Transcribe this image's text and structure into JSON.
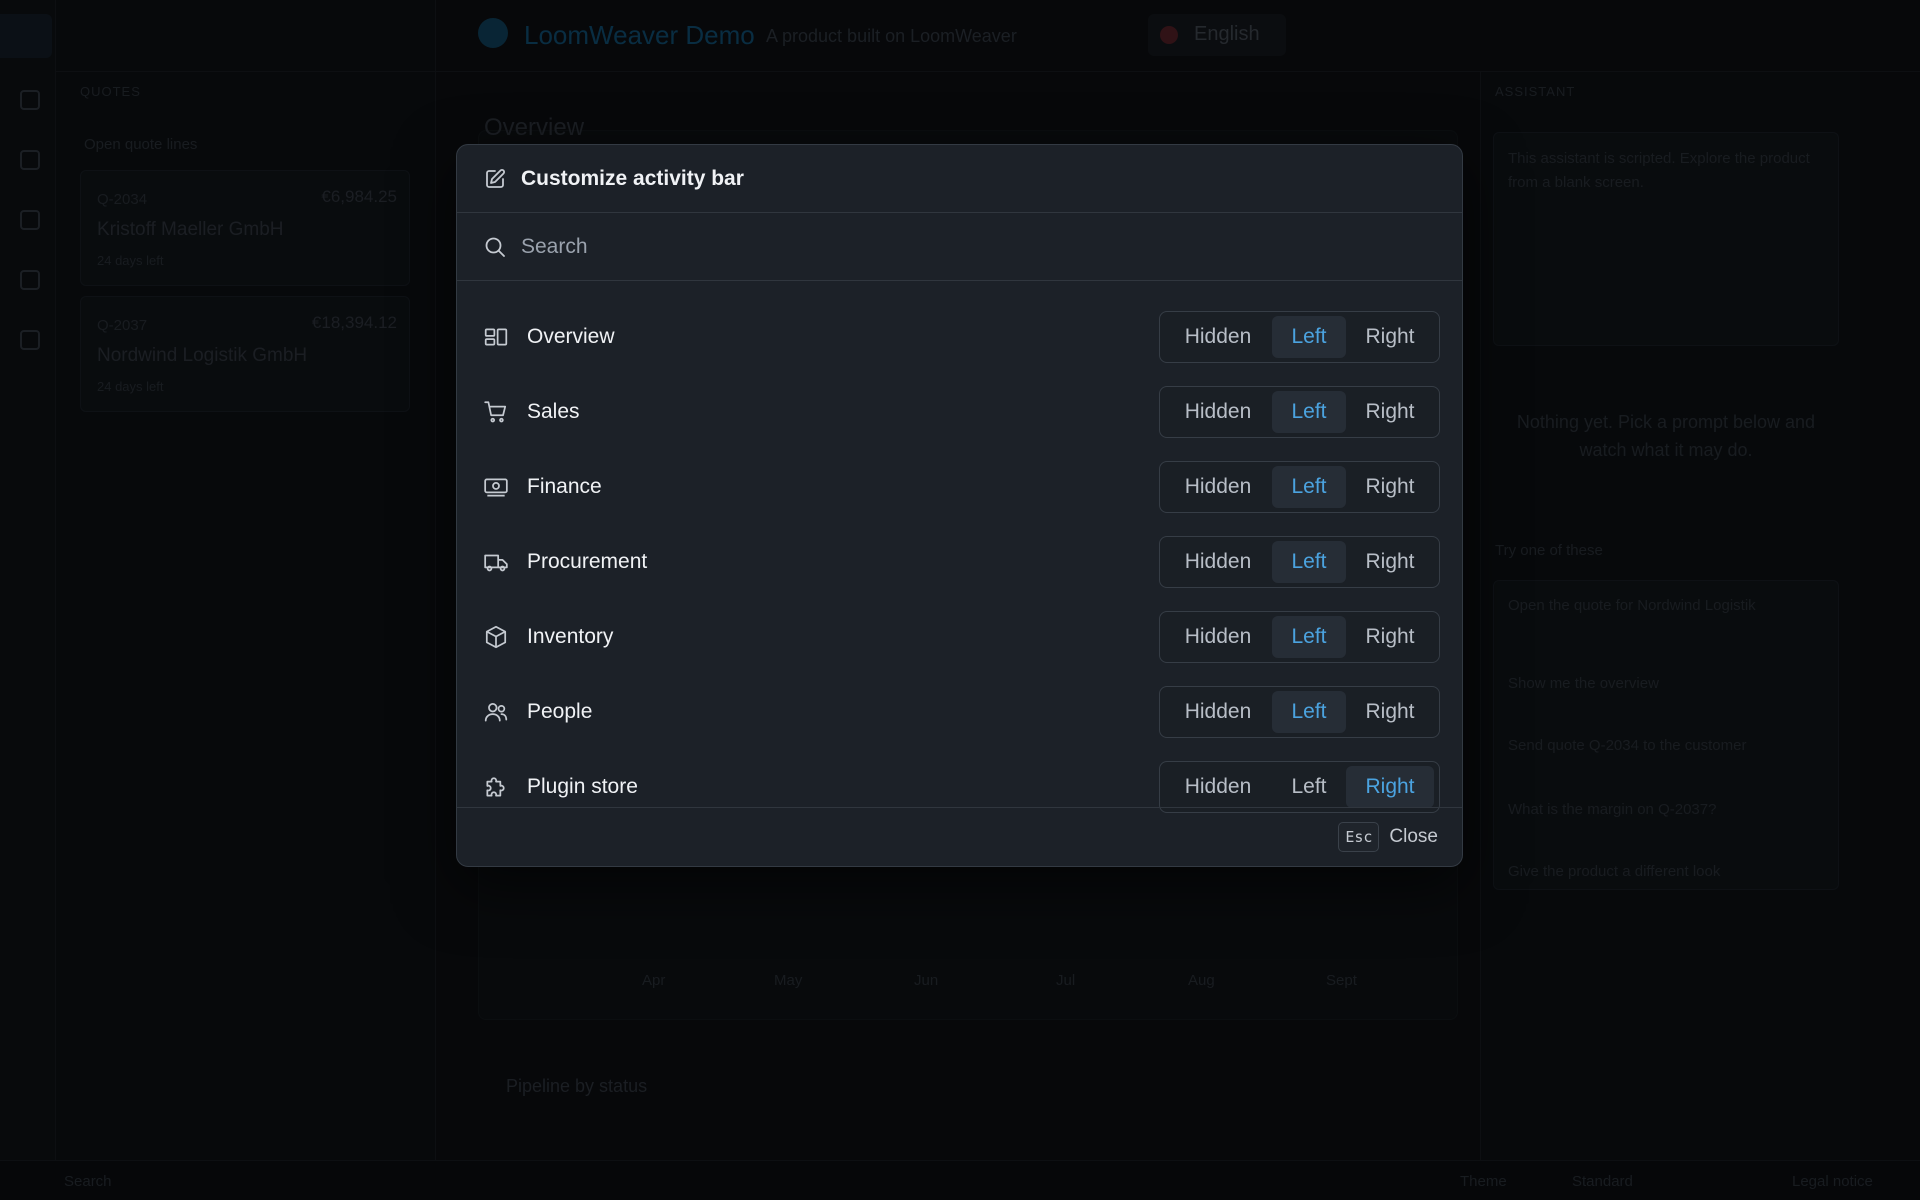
{
  "background": {
    "app_title": "LoomWeaver Demo",
    "app_subtitle": "A product built on LoomWeaver",
    "language": "English",
    "page_title": "Overview",
    "sidebar_header": "QUOTES",
    "sidebar_note": "Open quote lines",
    "quotes": [
      {
        "id": "Q-2034",
        "amount": "€6,984.25",
        "customer": "Kristoff Maeller GmbH",
        "date": "24 days left"
      },
      {
        "id": "Q-2037",
        "amount": "€18,394.12",
        "customer": "Nordwind Logistik GmbH",
        "date": "24 days left"
      }
    ],
    "assistant_header": "ASSISTANT",
    "assistant_text": "This assistant is scripted. Explore the product from a blank screen.",
    "assistant_empty": "Nothing yet. Pick a prompt below and watch what it may do.",
    "prompts_header": "Try one of these",
    "prompts": [
      "Open the quote for Nordwind Logistik",
      "Show me the overview",
      "Send quote Q-2034 to the customer",
      "What is the margin on Q-2037?",
      "Give the product a different look"
    ],
    "chart_months": [
      "Apr",
      "May",
      "Jun",
      "Jul",
      "Aug",
      "Sept"
    ],
    "pipeline_title": "Pipeline by status",
    "status_left": "Search",
    "status_theme_label": "Theme",
    "status_theme_value": "Standard",
    "status_right": "Legal notice"
  },
  "modal": {
    "title": "Customize activity bar",
    "title_icon": "edit-icon",
    "search_placeholder": "Search",
    "options": {
      "hidden": "Hidden",
      "left": "Left",
      "right": "Right"
    },
    "items": [
      {
        "label": "Overview",
        "icon": "overview-icon",
        "selected": "left"
      },
      {
        "label": "Sales",
        "icon": "cart-icon",
        "selected": "left"
      },
      {
        "label": "Finance",
        "icon": "banknote-icon",
        "selected": "left"
      },
      {
        "label": "Procurement",
        "icon": "truck-icon",
        "selected": "left"
      },
      {
        "label": "Inventory",
        "icon": "box-icon",
        "selected": "left"
      },
      {
        "label": "People",
        "icon": "users-icon",
        "selected": "left"
      },
      {
        "label": "Plugin store",
        "icon": "puzzle-icon",
        "selected": "right"
      }
    ],
    "footer": {
      "key": "Esc",
      "close_label": "Close"
    }
  },
  "colors": {
    "accent": "#4ba3e0",
    "modal_bg": "#1c2128",
    "page_bg": "#0b0d10"
  }
}
